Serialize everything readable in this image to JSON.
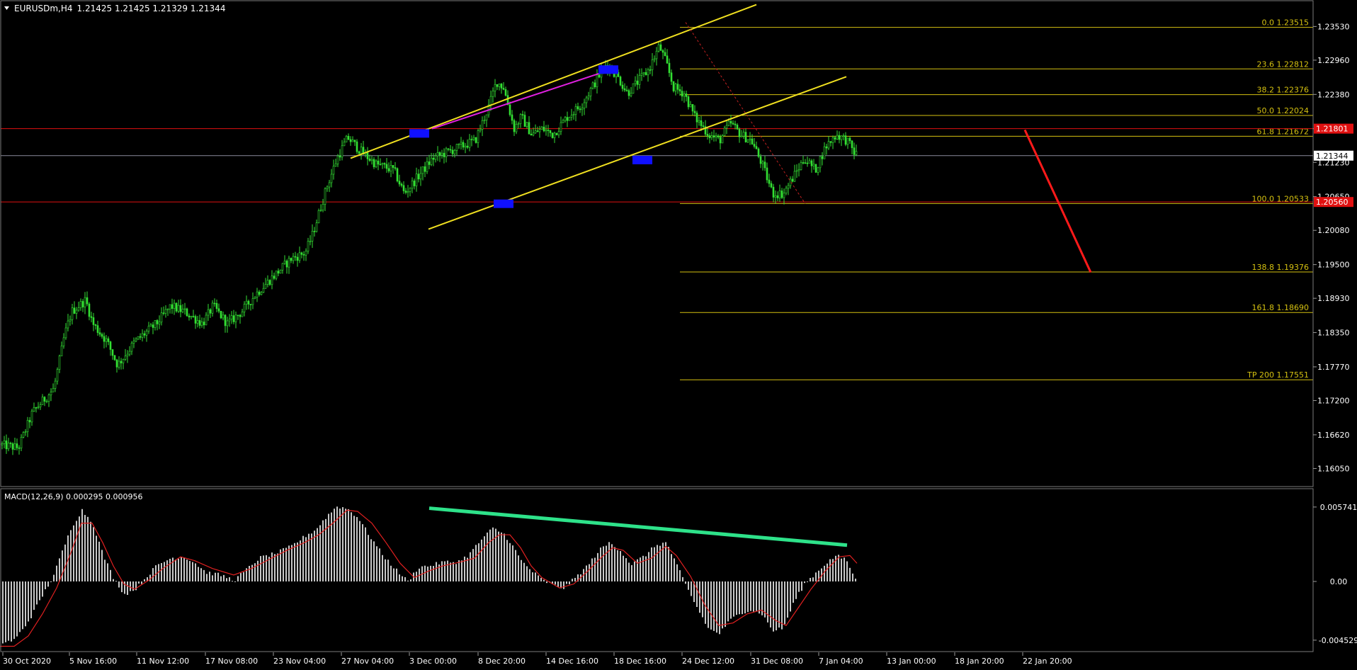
{
  "chart_data": [
    {
      "type": "candlestick",
      "symbol_label": "EURUSDm,H4",
      "ohlc_label": "1.21425 1.21425 1.21329 1.21344",
      "current_price": 1.21344,
      "current_price_label": "1.21344",
      "red_level_label": "1.21801",
      "red_level_2_label": "1.20560",
      "ylim": [
        1.1578,
        1.2393
      ],
      "price_ticks": [
        1.2353,
        1.2296,
        1.2238,
        1.218,
        1.2123,
        1.2065,
        1.2008,
        1.195,
        1.1893,
        1.1835,
        1.1777,
        1.172,
        1.1662,
        1.1605
      ],
      "price_tick_labels": [
        "1.23530",
        "1.22960",
        "1.22380",
        "1.21800",
        "1.21230",
        "1.20650",
        "1.20080",
        "1.19500",
        "1.18930",
        "1.18350",
        "1.17770",
        "1.17200",
        "1.16620",
        "1.16050"
      ],
      "time_labels": [
        "30 Oct 2020",
        "5 Nov 16:00",
        "11 Nov 12:00",
        "17 Nov 08:00",
        "23 Nov 04:00",
        "27 Nov 04:00",
        "3 Dec 00:00",
        "8 Dec 20:00",
        "14 Dec 16:00",
        "18 Dec 16:00",
        "24 Dec 12:00",
        "31 Dec 08:00",
        "7 Jan 04:00",
        "13 Jan 00:00",
        "18 Jan 20:00",
        "22 Jan 20:00"
      ],
      "close_path": [
        [
          0,
          1.1645
        ],
        [
          25,
          1.164
        ],
        [
          45,
          1.17
        ],
        [
          75,
          1.174
        ],
        [
          90,
          1.183
        ],
        [
          100,
          1.187
        ],
        [
          120,
          1.189
        ],
        [
          130,
          1.185
        ],
        [
          150,
          1.182
        ],
        [
          165,
          1.178
        ],
        [
          190,
          1.182
        ],
        [
          220,
          1.185
        ],
        [
          240,
          1.188
        ],
        [
          260,
          1.187
        ],
        [
          285,
          1.185
        ],
        [
          300,
          1.188
        ],
        [
          320,
          1.185
        ],
        [
          340,
          1.187
        ],
        [
          360,
          1.19
        ],
        [
          385,
          1.193
        ],
        [
          410,
          1.196
        ],
        [
          430,
          1.197
        ],
        [
          440,
          1.2
        ],
        [
          460,
          1.208
        ],
        [
          475,
          1.213
        ],
        [
          490,
          1.2165
        ],
        [
          510,
          1.214
        ],
        [
          530,
          1.212
        ],
        [
          555,
          1.211
        ],
        [
          570,
          1.207
        ],
        [
          590,
          1.21
        ],
        [
          610,
          1.213
        ],
        [
          630,
          1.214
        ],
        [
          650,
          1.215
        ],
        [
          670,
          1.216
        ],
        [
          690,
          1.222
        ],
        [
          700,
          1.226
        ],
        [
          710,
          1.225
        ],
        [
          725,
          1.218
        ],
        [
          735,
          1.22
        ],
        [
          750,
          1.217
        ],
        [
          765,
          1.218
        ],
        [
          780,
          1.217
        ],
        [
          800,
          1.22
        ],
        [
          820,
          1.222
        ],
        [
          840,
          1.226
        ],
        [
          855,
          1.229
        ],
        [
          870,
          1.227
        ],
        [
          885,
          1.224
        ],
        [
          900,
          1.226
        ],
        [
          915,
          1.228
        ],
        [
          930,
          1.232
        ],
        [
          940,
          1.229
        ],
        [
          950,
          1.225
        ],
        [
          965,
          1.224
        ],
        [
          980,
          1.22
        ],
        [
          1000,
          1.217
        ],
        [
          1015,
          1.216
        ],
        [
          1030,
          1.219
        ],
        [
          1045,
          1.217
        ],
        [
          1060,
          1.216
        ],
        [
          1075,
          1.212
        ],
        [
          1090,
          1.207
        ],
        [
          1105,
          1.207
        ],
        [
          1120,
          1.21
        ],
        [
          1135,
          1.213
        ],
        [
          1150,
          1.211
        ],
        [
          1165,
          1.215
        ],
        [
          1180,
          1.217
        ],
        [
          1195,
          1.216
        ],
        [
          1205,
          1.214
        ],
        [
          1210,
          1.21344
        ]
      ],
      "fibonacci_levels": [
        {
          "label": "0.0 1.23515",
          "price": 1.23515
        },
        {
          "label": "23.6 1.22812",
          "price": 1.22812
        },
        {
          "label": "38.2 1.22376",
          "price": 1.22376
        },
        {
          "label": "50.0 1.22024",
          "price": 1.22024
        },
        {
          "label": "61.8 1.21672",
          "price": 1.21672
        },
        {
          "label": "100.0 1.20533",
          "price": 1.20533
        },
        {
          "label": "138.8 1.19376",
          "price": 1.19376
        },
        {
          "label": "161.8 1.18690",
          "price": 1.1869
        },
        {
          "label": "TP 200 1.17551",
          "price": 1.17551
        }
      ],
      "horizontal_lines": [
        {
          "price": 1.21801,
          "color": "#e01010"
        },
        {
          "price": 1.2056,
          "color": "#e01010"
        },
        {
          "price": 1.21344,
          "color": "#8a8a9a"
        }
      ],
      "colors": {
        "candles": "#33e033",
        "channel": "#f0e020",
        "fib": "#d4c010",
        "magenta": "#e020e0",
        "forecast": "#ff1a1a",
        "marker": "#1010ff"
      }
    },
    {
      "type": "macd",
      "label": "MACD(12,26,9) 0.000295 0.000956",
      "ylim": [
        -0.0053,
        0.0065
      ],
      "tick_labels": [
        "0.005741",
        "0.00",
        "-0.004529"
      ],
      "tick_values": [
        0.005741,
        0.0,
        -0.004529
      ],
      "histogram_path": [
        [
          0,
          -0.0048
        ],
        [
          20,
          -0.0045
        ],
        [
          40,
          -0.003
        ],
        [
          60,
          -0.001
        ],
        [
          75,
          0.0005
        ],
        [
          85,
          0.002
        ],
        [
          100,
          0.0042
        ],
        [
          115,
          0.0055
        ],
        [
          130,
          0.0045
        ],
        [
          145,
          0.002
        ],
        [
          160,
          0.0002
        ],
        [
          175,
          -0.001
        ],
        [
          190,
          -0.0006
        ],
        [
          205,
          0.0003
        ],
        [
          220,
          0.0012
        ],
        [
          240,
          0.0018
        ],
        [
          260,
          0.0019
        ],
        [
          275,
          0.0014
        ],
        [
          290,
          0.0007
        ],
        [
          310,
          0.0005
        ],
        [
          330,
          0.0001
        ],
        [
          345,
          0.0008
        ],
        [
          365,
          0.0018
        ],
        [
          390,
          0.0022
        ],
        [
          410,
          0.0027
        ],
        [
          430,
          0.0035
        ],
        [
          445,
          0.004
        ],
        [
          460,
          0.005
        ],
        [
          475,
          0.0058
        ],
        [
          490,
          0.0056
        ],
        [
          505,
          0.0049
        ],
        [
          520,
          0.0036
        ],
        [
          540,
          0.002
        ],
        [
          560,
          0.0008
        ],
        [
          575,
          0.0
        ],
        [
          590,
          0.0011
        ],
        [
          605,
          0.0012
        ],
        [
          625,
          0.0015
        ],
        [
          645,
          0.0015
        ],
        [
          660,
          0.002
        ],
        [
          680,
          0.0033
        ],
        [
          695,
          0.0041
        ],
        [
          710,
          0.0037
        ],
        [
          720,
          0.003
        ],
        [
          735,
          0.0016
        ],
        [
          750,
          0.0008
        ],
        [
          765,
          0.0001
        ],
        [
          780,
          -0.0003
        ],
        [
          795,
          -0.0005
        ],
        [
          810,
          0.0002
        ],
        [
          830,
          0.0013
        ],
        [
          845,
          0.0024
        ],
        [
          860,
          0.003
        ],
        [
          875,
          0.0024
        ],
        [
          890,
          0.0013
        ],
        [
          910,
          0.002
        ],
        [
          925,
          0.0028
        ],
        [
          940,
          0.003
        ],
        [
          955,
          0.0012
        ],
        [
          970,
          -0.0006
        ],
        [
          985,
          -0.0022
        ],
        [
          1000,
          -0.0037
        ],
        [
          1015,
          -0.004
        ],
        [
          1030,
          -0.003
        ],
        [
          1045,
          -0.0024
        ],
        [
          1060,
          -0.0022
        ],
        [
          1075,
          -0.0025
        ],
        [
          1090,
          -0.0038
        ],
        [
          1105,
          -0.0036
        ],
        [
          1120,
          -0.0016
        ],
        [
          1135,
          -0.0002
        ],
        [
          1150,
          0.0006
        ],
        [
          1165,
          0.0014
        ],
        [
          1180,
          0.002
        ],
        [
          1195,
          0.0016
        ],
        [
          1205,
          0.0003
        ]
      ],
      "signal_path": [
        [
          0,
          -0.005
        ],
        [
          20,
          -0.005
        ],
        [
          40,
          -0.0042
        ],
        [
          60,
          -0.0025
        ],
        [
          80,
          -0.0005
        ],
        [
          100,
          0.0022
        ],
        [
          115,
          0.0045
        ],
        [
          130,
          0.0045
        ],
        [
          145,
          0.003
        ],
        [
          160,
          0.0012
        ],
        [
          175,
          -0.0002
        ],
        [
          190,
          -0.0006
        ],
        [
          210,
          0.0001
        ],
        [
          230,
          0.001
        ],
        [
          255,
          0.0019
        ],
        [
          275,
          0.0016
        ],
        [
          300,
          0.001
        ],
        [
          330,
          0.0005
        ],
        [
          355,
          0.001
        ],
        [
          380,
          0.0017
        ],
        [
          405,
          0.0024
        ],
        [
          430,
          0.003
        ],
        [
          450,
          0.0036
        ],
        [
          470,
          0.0045
        ],
        [
          490,
          0.0055
        ],
        [
          505,
          0.0054
        ],
        [
          525,
          0.0045
        ],
        [
          545,
          0.003
        ],
        [
          565,
          0.0014
        ],
        [
          585,
          0.0003
        ],
        [
          605,
          0.0008
        ],
        [
          625,
          0.0012
        ],
        [
          650,
          0.0015
        ],
        [
          670,
          0.0018
        ],
        [
          690,
          0.003
        ],
        [
          705,
          0.0036
        ],
        [
          720,
          0.0036
        ],
        [
          735,
          0.0026
        ],
        [
          750,
          0.0012
        ],
        [
          765,
          0.0003
        ],
        [
          790,
          -0.0005
        ],
        [
          810,
          -0.0002
        ],
        [
          830,
          0.0008
        ],
        [
          850,
          0.0019
        ],
        [
          865,
          0.0026
        ],
        [
          880,
          0.0024
        ],
        [
          900,
          0.0014
        ],
        [
          920,
          0.0018
        ],
        [
          940,
          0.0027
        ],
        [
          955,
          0.002
        ],
        [
          975,
          0.0004
        ],
        [
          995,
          -0.0018
        ],
        [
          1015,
          -0.0034
        ],
        [
          1035,
          -0.0032
        ],
        [
          1055,
          -0.0025
        ],
        [
          1075,
          -0.0022
        ],
        [
          1095,
          -0.003
        ],
        [
          1110,
          -0.0034
        ],
        [
          1125,
          -0.0022
        ],
        [
          1145,
          -0.0006
        ],
        [
          1165,
          0.0008
        ],
        [
          1185,
          0.0019
        ],
        [
          1200,
          0.002
        ],
        [
          1210,
          0.0014
        ]
      ],
      "divergence_line_color": "#2ee28a"
    }
  ]
}
